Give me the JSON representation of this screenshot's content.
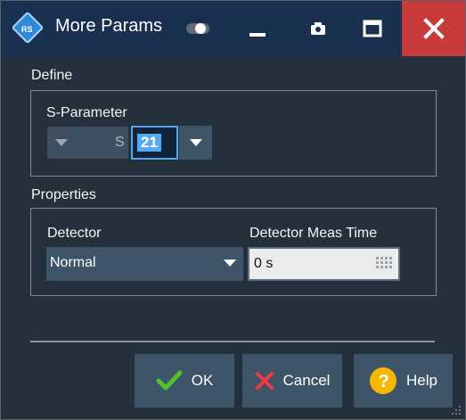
{
  "window": {
    "title": "More Params"
  },
  "define": {
    "title": "Define",
    "s_parameter_label": "S-Parameter",
    "prefix": "S",
    "value": "21"
  },
  "properties": {
    "title": "Properties",
    "detector_label": "Detector",
    "detector_value": "Normal",
    "meas_time_label": "Detector Meas Time",
    "meas_time_value": "0 s"
  },
  "buttons": {
    "ok": "OK",
    "cancel": "Cancel",
    "help": "Help"
  },
  "colors": {
    "title_bar": "#1a3050",
    "background": "#24303b",
    "close": "#c93b3b",
    "accent": "#56a5ef",
    "ok": "#4ec32a",
    "cancel": "#ef3b45",
    "help": "#f5b700"
  },
  "icons": [
    "logo-icon",
    "toggle-icon",
    "minimize-icon",
    "camera-icon",
    "maximize-icon",
    "close-icon",
    "checkmark-icon",
    "x-icon",
    "help-icon",
    "keypad-icon",
    "chevron-down-icon",
    "resize-grip-icon"
  ]
}
